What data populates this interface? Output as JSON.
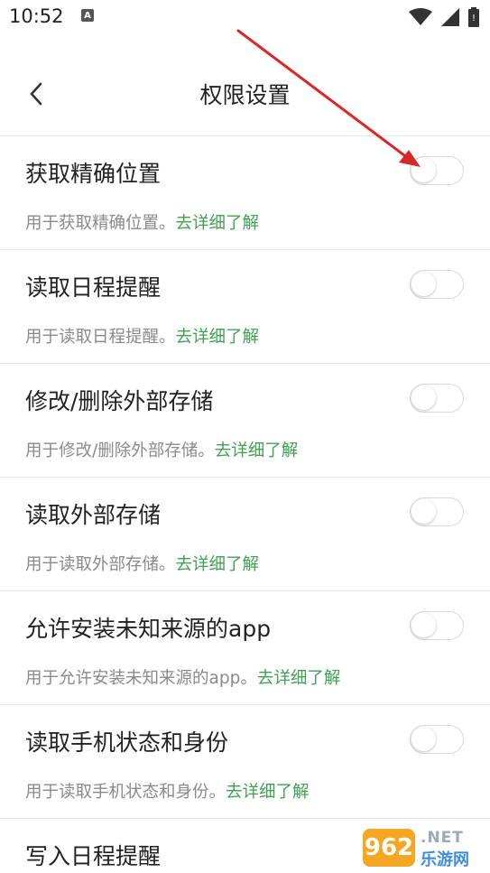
{
  "status_bar": {
    "time": "10:52",
    "notification_icon": "A",
    "icons": [
      "wifi-icon",
      "signal-icon",
      "battery-icon"
    ]
  },
  "header": {
    "title": "权限设置",
    "back_icon": "chevron-left-icon"
  },
  "permissions": [
    {
      "title": "获取精确位置",
      "desc": "用于获取精确位置。",
      "link": "去详细了解",
      "enabled": false
    },
    {
      "title": "读取日程提醒",
      "desc": "用于读取日程提醒。",
      "link": "去详细了解",
      "enabled": false
    },
    {
      "title": "修改/删除外部存储",
      "desc": "用于修改/删除外部存储。",
      "link": "去详细了解",
      "enabled": false
    },
    {
      "title": "读取外部存储",
      "desc": "用于读取外部存储。",
      "link": "去详细了解",
      "enabled": false
    },
    {
      "title": "允许安装未知来源的app",
      "desc": "用于允许安装未知来源的app。",
      "link": "去详细了解",
      "enabled": false
    },
    {
      "title": "读取手机状态和身份",
      "desc": "用于读取手机状态和身份。",
      "link": "去详细了解",
      "enabled": false
    },
    {
      "title": "写入日程提醒",
      "desc": "",
      "link": "",
      "enabled": false
    }
  ],
  "watermark": {
    "badge": "962",
    "net": ".NET",
    "site": "乐游网"
  },
  "colors": {
    "link": "#3fa152",
    "desc": "#8a8a8a",
    "divider": "#e8e8e8",
    "arrow": "#d42a2a",
    "watermark_badge": "#f5a623"
  }
}
